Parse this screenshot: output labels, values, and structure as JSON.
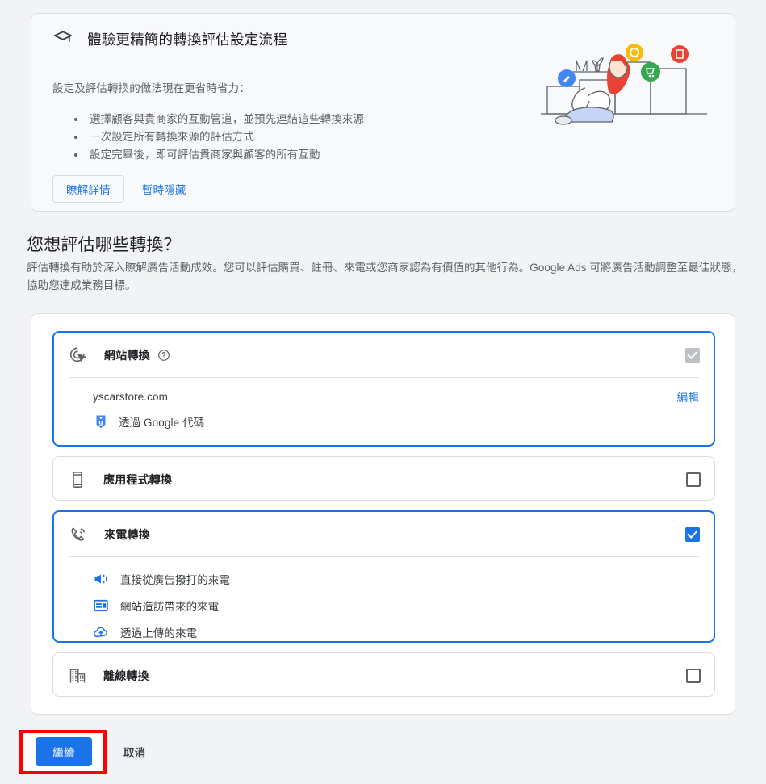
{
  "promo": {
    "icon": "graduation-cap-icon",
    "title": "體驗更精簡的轉換評估設定流程",
    "subtitle": "設定及評估轉換的做法現在更省時省力：",
    "bullets": [
      "選擇顧客與貴商家的互動管道，並預先連結這些轉換來源",
      "一次設定所有轉換來源的評估方式",
      "設定完畢後，即可評估貴商家與顧客的所有互動"
    ],
    "learn_more_label": "瞭解詳情",
    "dismiss_label": "暫時隱藏",
    "illustration": "person-with-bar-chart-illustration"
  },
  "section": {
    "title": "您想評估哪些轉換？",
    "description": "評估轉換有助於深入瞭解廣告活動成效。您可以評估購買、註冊、來電或您商家認為有價值的其他行為。Google Ads 可將廣告活動調整至最佳狀態，協助您達成業務目標。"
  },
  "options": [
    {
      "id": "website",
      "icon": "ads-click-target-icon",
      "label": "網站轉換",
      "help_icon": "help-circle-icon",
      "selected": true,
      "checkbox_state": "checked-disabled",
      "details": {
        "url": "yscarstore.com",
        "edit_label": "編輯",
        "tag_icon": "google-tag-icon",
        "tag_text": "透過 Google 代碼"
      }
    },
    {
      "id": "app",
      "icon": "mobile-phone-icon",
      "label": "應用程式轉換",
      "selected": false,
      "checkbox_state": "unchecked"
    },
    {
      "id": "calls",
      "icon": "ring-volume-phone-icon",
      "label": "來電轉換",
      "selected": true,
      "checkbox_state": "checked",
      "sub_items": [
        {
          "icon": "campaign-megaphone-icon",
          "label": "直接從廣告撥打的來電"
        },
        {
          "icon": "web-page-layout-icon",
          "label": "網站造訪帶來的來電"
        },
        {
          "icon": "cloud-upload-icon",
          "label": "透過上傳的來電"
        }
      ]
    },
    {
      "id": "offline",
      "icon": "office-building-icon",
      "label": "離線轉換",
      "selected": false,
      "checkbox_state": "unchecked"
    }
  ],
  "footer": {
    "continue_label": "繼續",
    "cancel_label": "取消",
    "highlight_color": "#ff0000"
  },
  "colors": {
    "accent": "#1a73e8",
    "page_background": "#f1f3f4",
    "card_background": "#ffffff",
    "promo_background": "#f8f9fa",
    "text_primary": "#202124",
    "text_secondary": "#5f6368",
    "border": "#dadce0"
  }
}
